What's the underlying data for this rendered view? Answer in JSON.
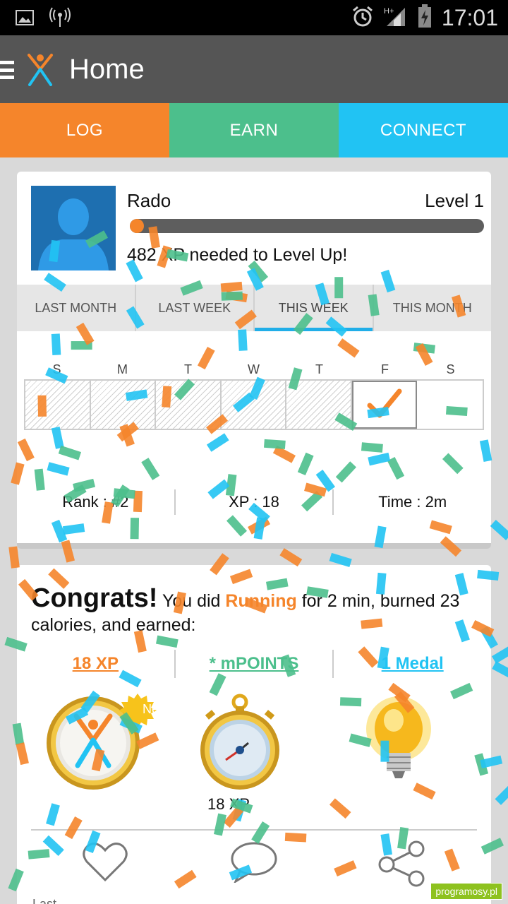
{
  "status_bar": {
    "time": "17:01",
    "network": "H+"
  },
  "app_bar": {
    "title": "Home"
  },
  "main_tabs": [
    {
      "label": "LOG",
      "color": "#f5852b"
    },
    {
      "label": "EARN",
      "color": "#4cbf8c"
    },
    {
      "label": "CONNECT",
      "color": "#21c3f3"
    }
  ],
  "profile": {
    "name": "Rado",
    "level": "Level 1",
    "xp_needed": "482 XP needed to Level Up!",
    "xp_progress": 0.04
  },
  "period_tabs": [
    {
      "label": "LAST MONTH",
      "active": false
    },
    {
      "label": "LAST WEEK",
      "active": false
    },
    {
      "label": "THIS WEEK",
      "active": true
    },
    {
      "label": "THIS MONTH",
      "active": false
    }
  ],
  "week_days": [
    "S",
    "M",
    "T",
    "W",
    "T",
    "F",
    "S"
  ],
  "stats": {
    "rank": "Rank : #2",
    "xp": "XP : 18",
    "time": "Time : 2m"
  },
  "congrats": {
    "title": "Congrats!",
    "text_before": " You did ",
    "activity": "Running",
    "text_after": " for 2 min, burned 23 calories, and earned:"
  },
  "rewards": {
    "xp": "18 XP",
    "points": "* mPOINTS",
    "medal": "1 Medal"
  },
  "badges": {
    "new_label": "New",
    "stopwatch_label": "18 XP"
  },
  "bottom_label": "Last",
  "watermark": "programosy.pl"
}
